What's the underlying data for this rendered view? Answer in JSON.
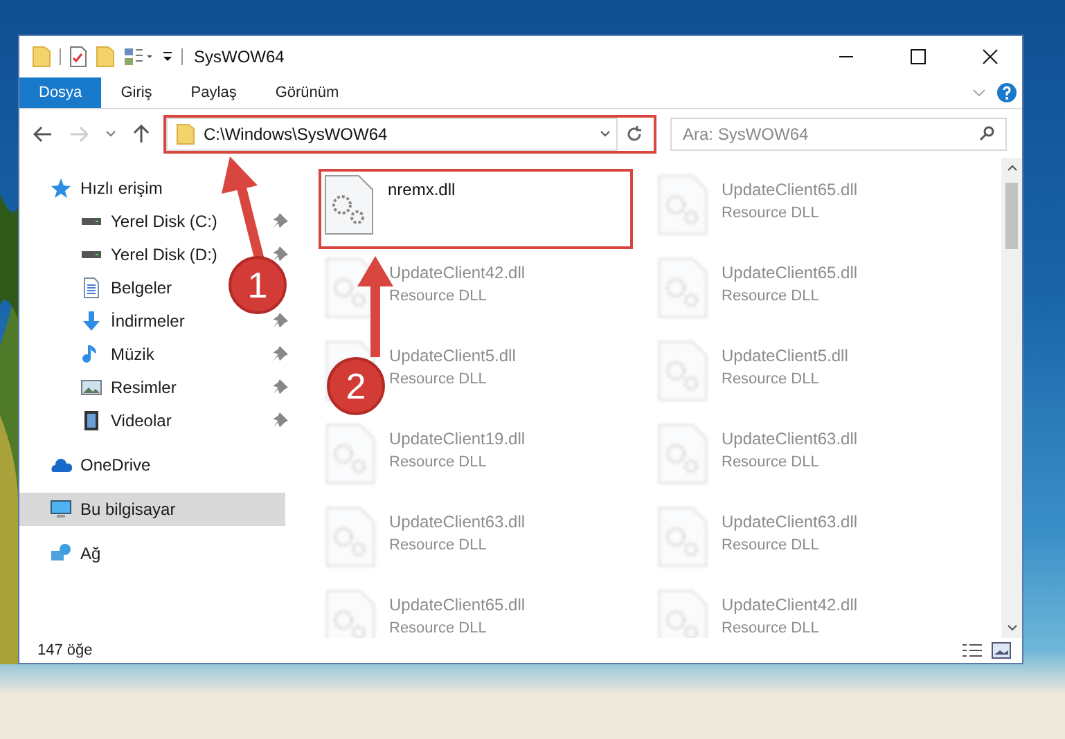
{
  "window": {
    "title": "SysWOW64"
  },
  "ribbon_tabs": [
    {
      "label": "Dosya",
      "selected": true
    },
    {
      "label": "Giriş",
      "selected": false
    },
    {
      "label": "Paylaş",
      "selected": false
    },
    {
      "label": "Görünüm",
      "selected": false
    }
  ],
  "address": {
    "path": "C:\\Windows\\SysWOW64",
    "highlighted": true
  },
  "search": {
    "placeholder": "Ara: SysWOW64"
  },
  "sidebar": {
    "items": [
      {
        "label": "Hızlı erişim",
        "kind": "star",
        "selected": false,
        "children": [
          {
            "label": "Yerel Disk (C:)",
            "kind": "disk",
            "selected": false,
            "pinned": true
          },
          {
            "label": "Yerel Disk (D:)",
            "kind": "disk",
            "selected": false,
            "pinned": true
          },
          {
            "label": "Belgeler",
            "kind": "document",
            "selected": false,
            "pinned": false
          },
          {
            "label": "İndirmeler",
            "kind": "download",
            "selected": false,
            "pinned": true
          },
          {
            "label": "Müzik",
            "kind": "music",
            "selected": false,
            "pinned": true
          },
          {
            "label": "Resimler",
            "selected": false,
            "pinned": true
          },
          {
            "label": "Videolar",
            "kind": "video",
            "selected": false,
            "pinned": true
          }
        ]
      },
      {
        "label": "OneDrive",
        "kind": "cloud",
        "selected": false
      },
      {
        "label": "Bu bilgisayar",
        "kind": "computer",
        "selected": true
      },
      {
        "label": "Ağ",
        "kind": "network",
        "selected": false
      }
    ]
  },
  "files": [
    {
      "name": "nremx.dll",
      "blurred": false,
      "highlighted": true
    },
    {
      "name": "UpdateClient65.dll",
      "type": "Resource DLL",
      "blurred": true
    },
    {
      "name": "UpdateClient42.dll",
      "type": "Resource DLL",
      "blurred": true
    },
    {
      "name": "UpdateClient65.dll",
      "type": "Resource DLL",
      "blurred": true
    },
    {
      "name": "UpdateClient5.dll",
      "type": "Resource DLL",
      "blurred": true
    },
    {
      "name": "UpdateClient5.dll",
      "type": "Resource DLL",
      "blurred": true
    },
    {
      "name": "UpdateClient19.dll",
      "type": "Resource DLL",
      "blurred": true
    },
    {
      "name": "UpdateClient63.dll",
      "type": "Resource DLL",
      "blurred": true
    },
    {
      "name": "UpdateClient63.dll",
      "type": "Resource DLL",
      "blurred": true
    },
    {
      "name": "UpdateClient63.dll",
      "type": "Resource DLL",
      "blurred": true
    },
    {
      "name": "UpdateClient65.dll",
      "type": "Resource DLL",
      "blurred": true
    },
    {
      "name": "UpdateClient42.dll",
      "type": "Resource DLL",
      "blurred": true
    }
  ],
  "annotations": [
    {
      "label": "1"
    },
    {
      "label": "2"
    }
  ],
  "status_bar": {
    "count": "147 öğe"
  }
}
